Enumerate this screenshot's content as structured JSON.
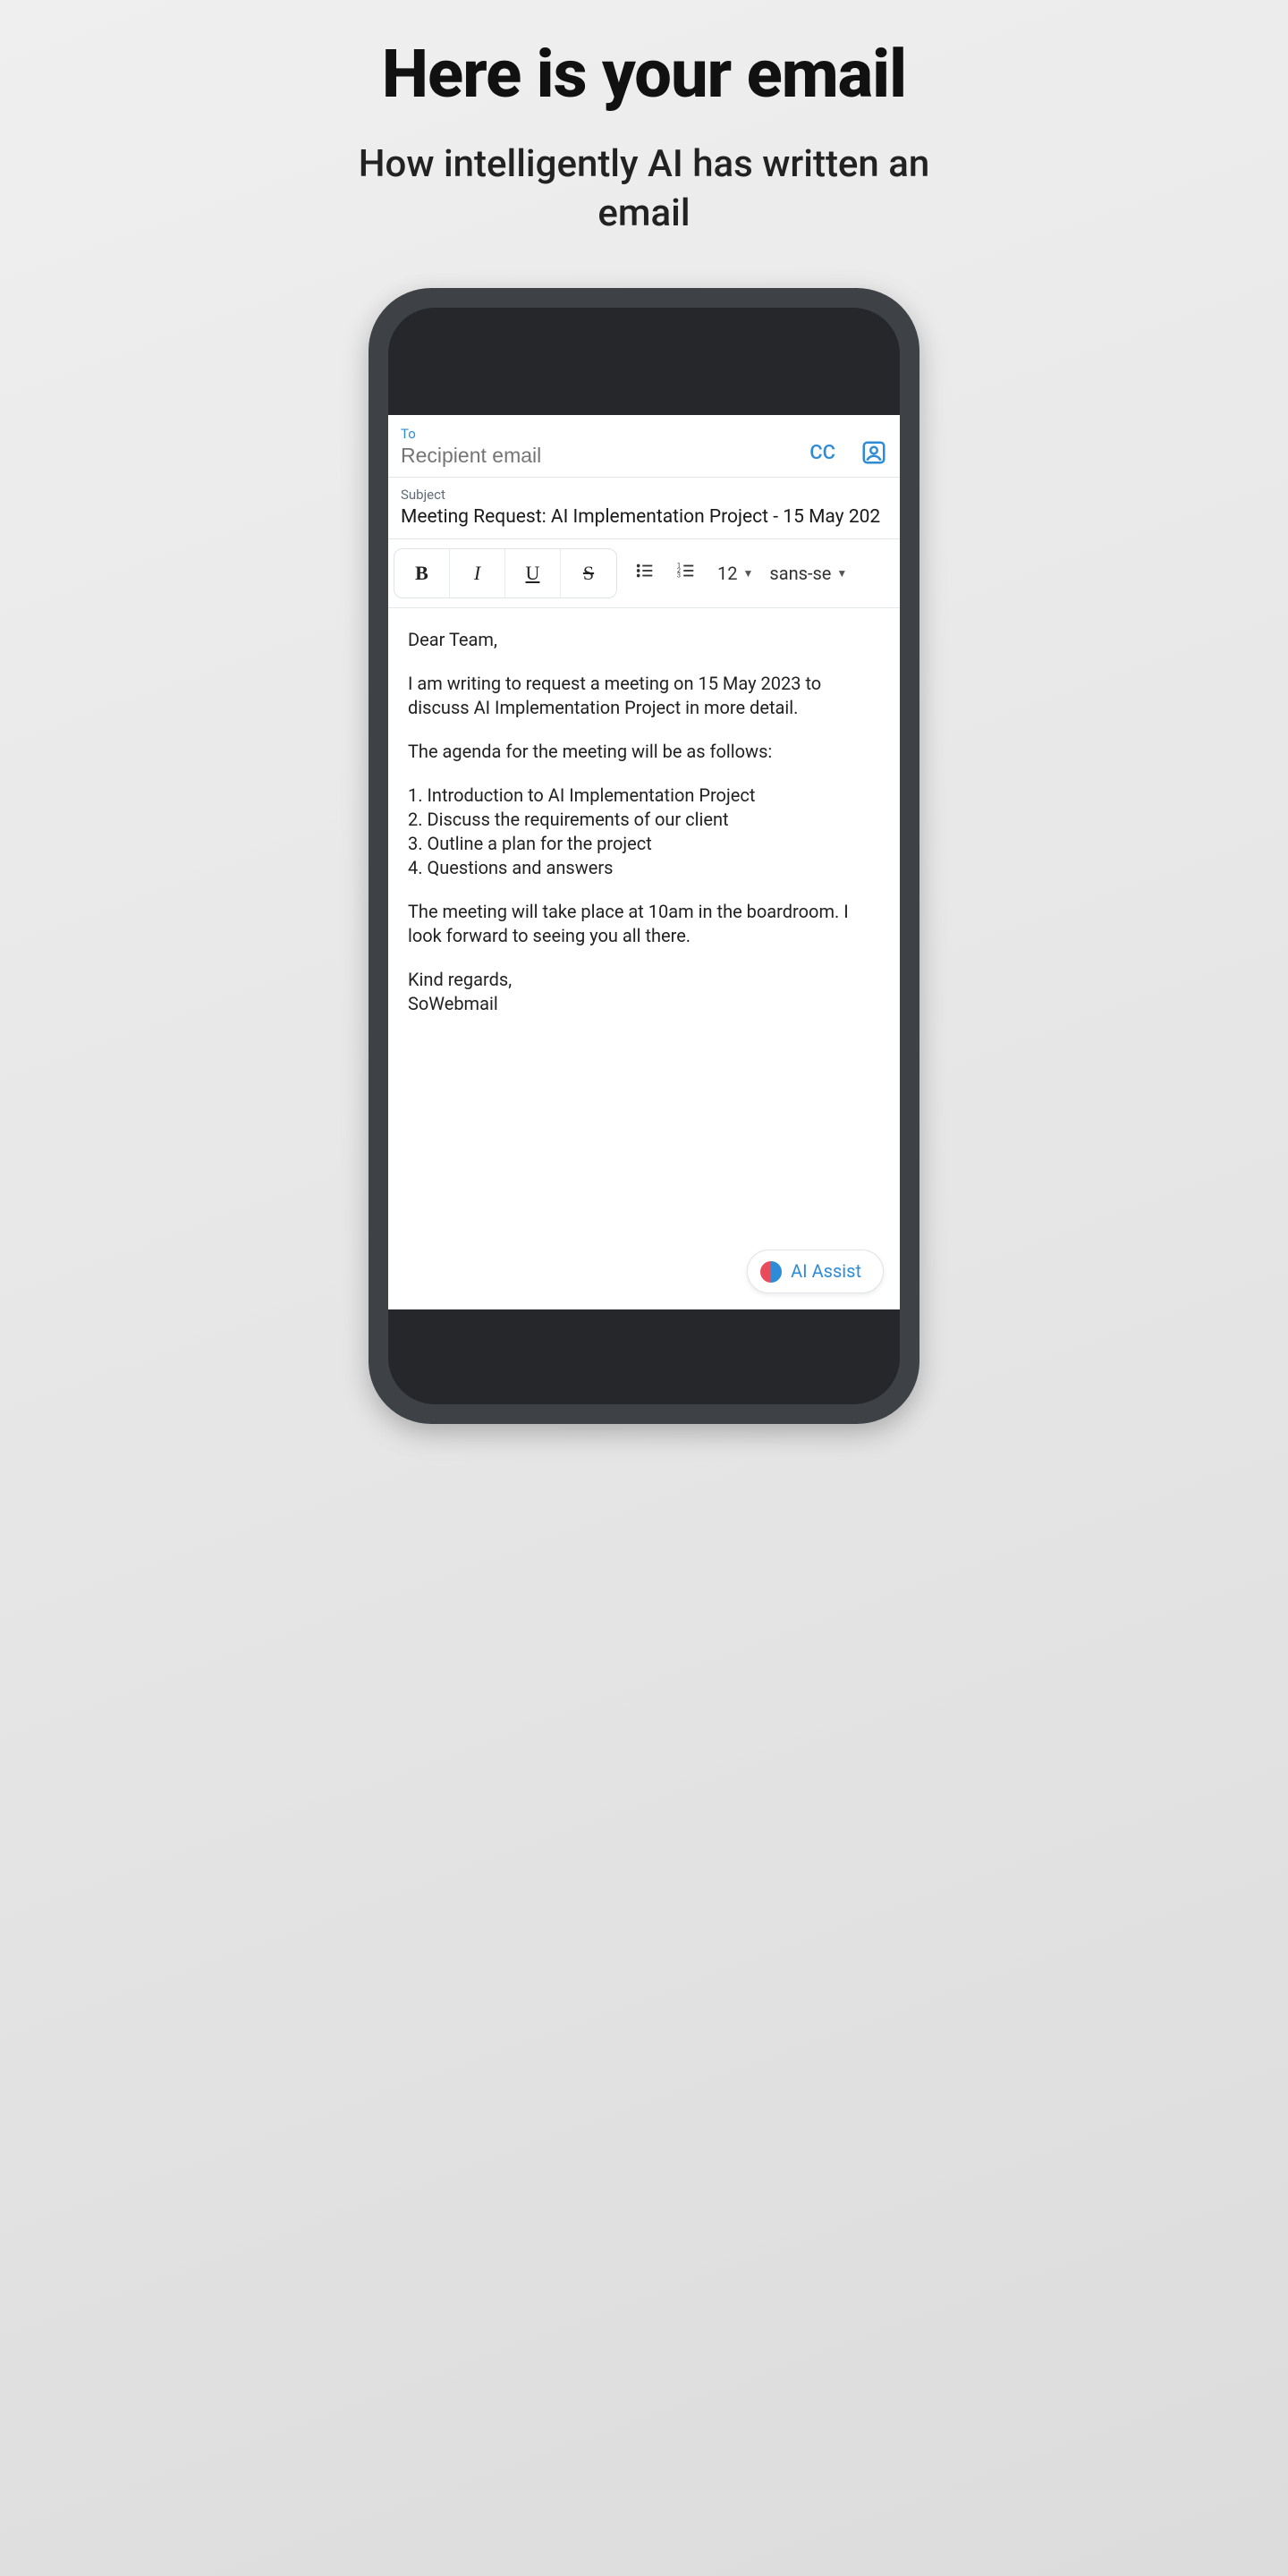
{
  "hero": {
    "title": "Here is your email",
    "subtitle": "How intelligently AI has written an email"
  },
  "compose": {
    "to_label": "To",
    "to_placeholder": "Recipient email",
    "cc_label": "CC",
    "subject_label": "Subject",
    "subject_value": "Meeting Request: AI Implementation Project - 15 May 202"
  },
  "toolbar": {
    "bold": "B",
    "italic": "I",
    "underline": "U",
    "strike": "S",
    "font_size": "12",
    "font_family": "sans-se"
  },
  "body": {
    "greeting": "Dear Team,",
    "intro": "I am writing to request a meeting on 15 May 2023 to discuss AI Implementation Project in more detail.",
    "agenda_intro": "The agenda for the meeting will be as follows:",
    "agenda": [
      "1. Introduction to AI Implementation Project",
      "2. Discuss the requirements of our client",
      "3. Outline a plan for the project",
      "4. Questions and answers"
    ],
    "closing": "The meeting will take place at 10am in the boardroom. I look forward to seeing you all there.",
    "signoff": "Kind regards,",
    "signature": "SoWebmail"
  },
  "ai_assist_label": "AI Assist"
}
